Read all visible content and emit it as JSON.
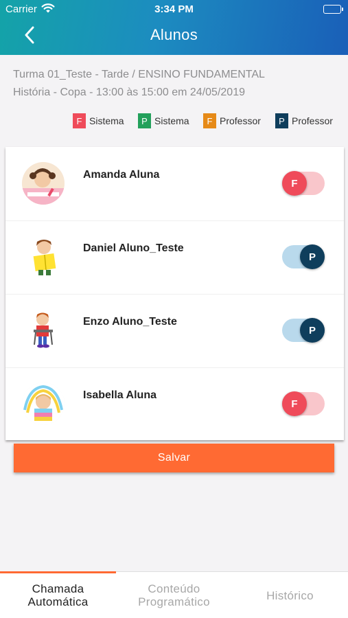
{
  "status_bar": {
    "carrier": "Carrier",
    "time": "3:34 PM"
  },
  "header": {
    "title": "Alunos",
    "back_icon": "chevron-left-icon"
  },
  "class_info": {
    "line1": "Turma 01_Teste - Tarde / ENSINO FUNDAMENTAL",
    "line2": "História - Copa - 13:00 às 15:00 em 24/05/2019"
  },
  "legend": [
    {
      "letter": "F",
      "label": "Sistema",
      "color": "#ef4b5a"
    },
    {
      "letter": "P",
      "label": "Sistema",
      "color": "#23a05b"
    },
    {
      "letter": "F",
      "label": "Professor",
      "color": "#e68a18"
    },
    {
      "letter": "P",
      "label": "Professor",
      "color": "#0f3e5c"
    }
  ],
  "students": [
    {
      "name": "Amanda Aluna",
      "status": "F",
      "present": false
    },
    {
      "name": "Daniel Aluno_Teste",
      "status": "P",
      "present": true
    },
    {
      "name": "Enzo Aluno_Teste",
      "status": "P",
      "present": true
    },
    {
      "name": "Isabella Aluna",
      "status": "F",
      "present": false
    }
  ],
  "save_label": "Salvar",
  "tabs": [
    {
      "line1": "Chamada",
      "line2": "Automática",
      "active": true
    },
    {
      "line1": "Conteúdo",
      "line2": "Programático",
      "active": false
    },
    {
      "line1": "Histórico",
      "line2": "",
      "active": false
    }
  ],
  "colors": {
    "accent": "#ff6a33",
    "absent": "#ef4b5a",
    "present": "#0f3e5c"
  }
}
